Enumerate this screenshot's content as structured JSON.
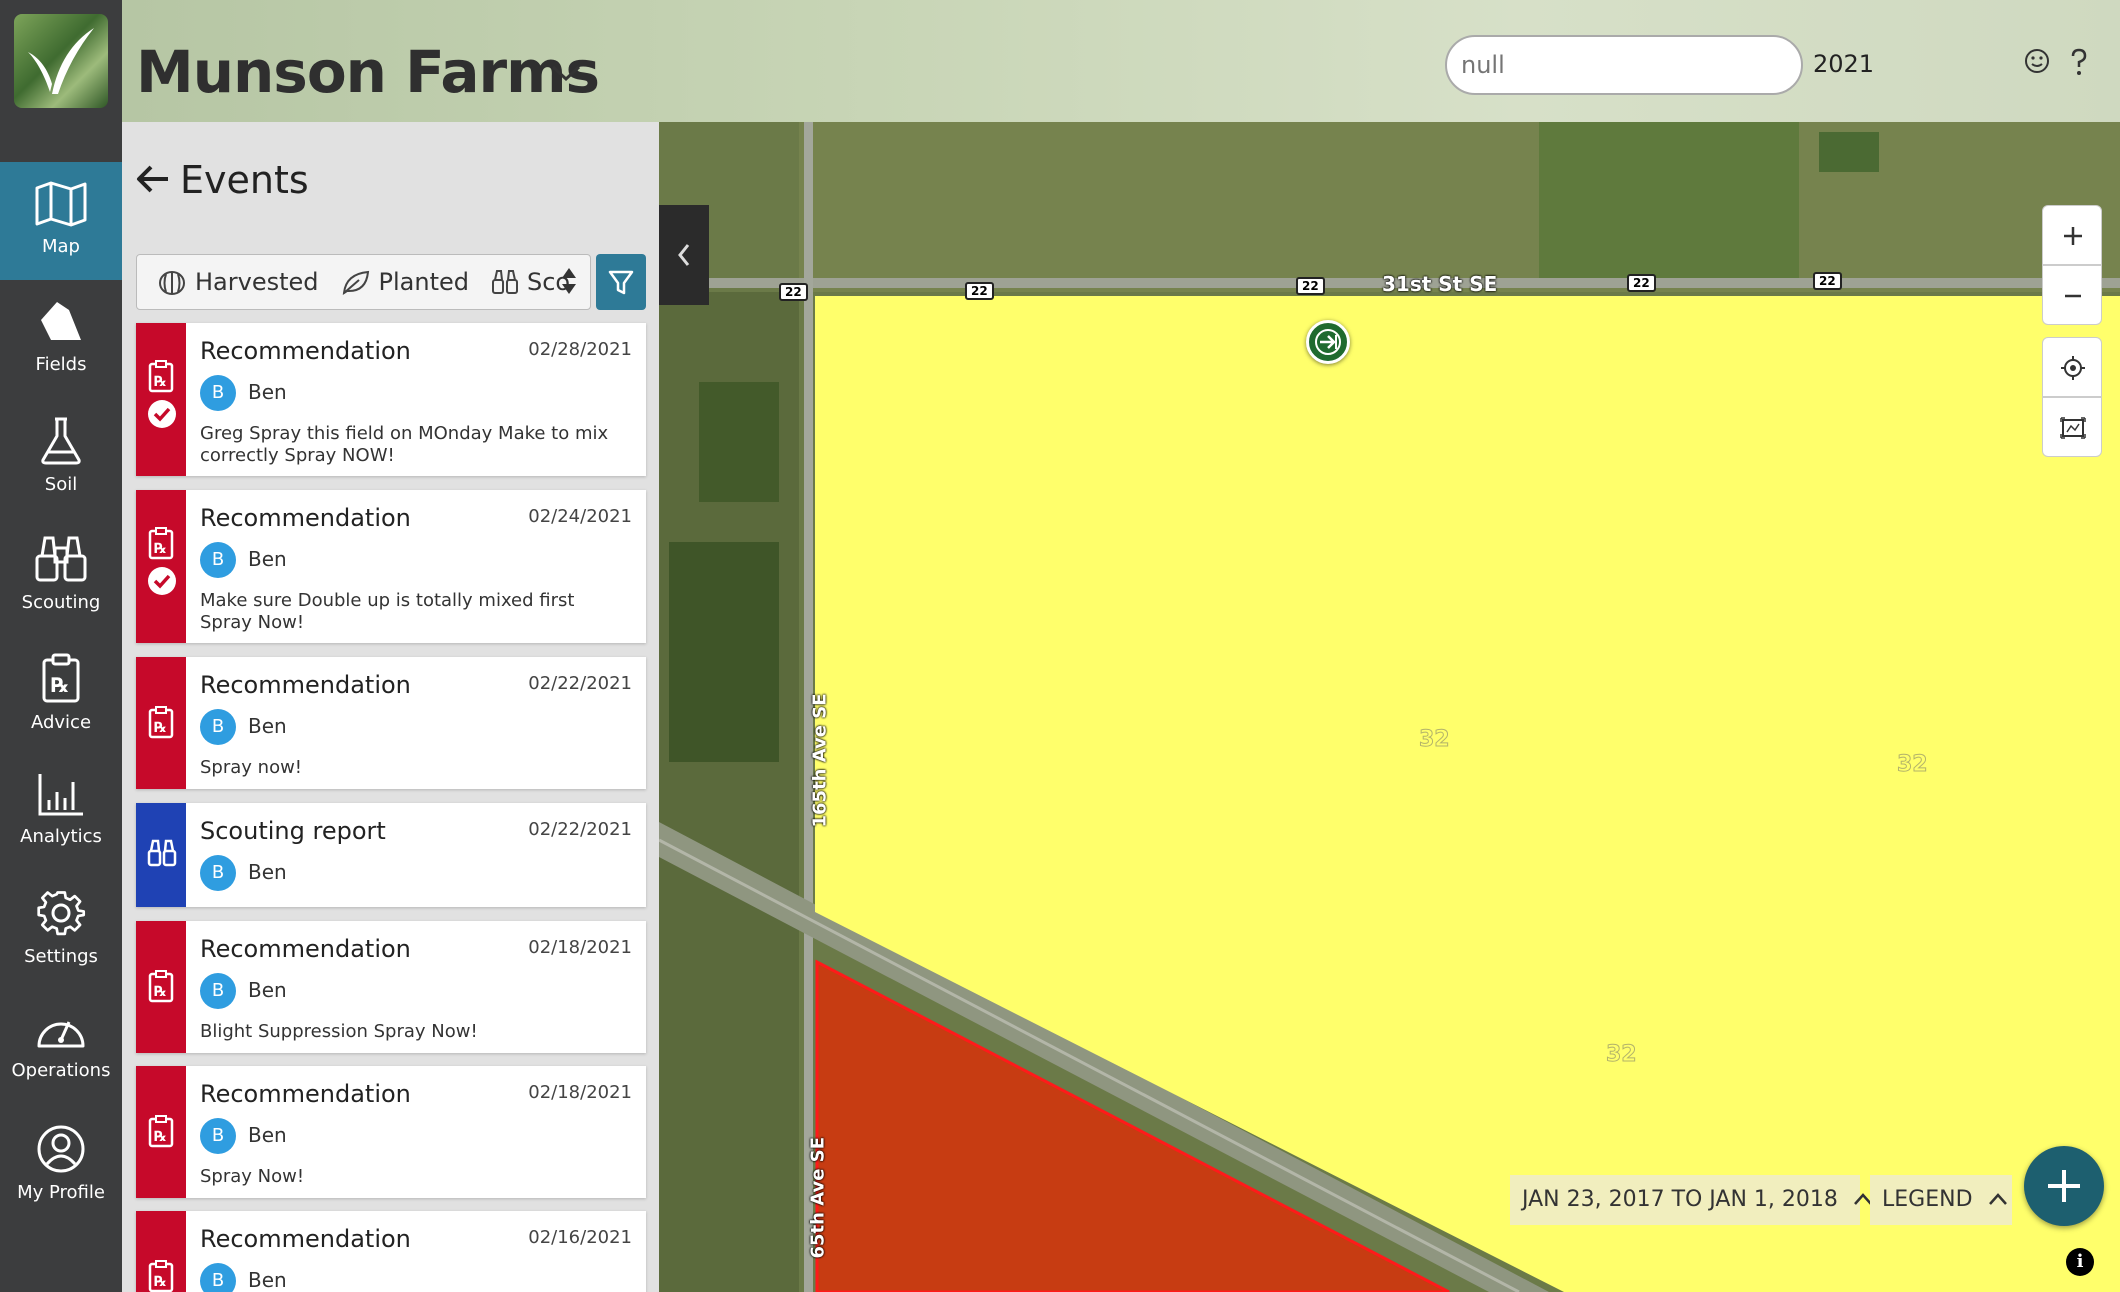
{
  "header": {
    "farm_name": "Munson Farms",
    "search_placeholder": "null",
    "year": "2021"
  },
  "nav": {
    "items": [
      {
        "label": "Map",
        "icon": "map-icon",
        "active": true
      },
      {
        "label": "Fields",
        "icon": "fields-icon"
      },
      {
        "label": "Soil",
        "icon": "flask-icon"
      },
      {
        "label": "Scouting",
        "icon": "binoculars-icon"
      },
      {
        "label": "Advice",
        "icon": "prescription-clipboard-icon"
      },
      {
        "label": "Analytics",
        "icon": "bar-chart-icon"
      },
      {
        "label": "Settings",
        "icon": "gear-icon"
      },
      {
        "label": "Operations",
        "icon": "gauge-icon"
      },
      {
        "label": "My Profile",
        "icon": "user-circle-icon"
      }
    ]
  },
  "panel": {
    "title": "Events",
    "filters": [
      {
        "label": "Harvested",
        "icon": "harvest-icon"
      },
      {
        "label": "Planted",
        "icon": "leaf-icon"
      },
      {
        "label": "Sco",
        "icon": "binoculars-icon"
      }
    ],
    "events": [
      {
        "type": "Recommendation",
        "date": "02/28/2021",
        "initial": "B",
        "user": "Ben",
        "note": "Greg Spray this field on MOnday Make to mix correctly Spray NOW!",
        "kind": "rx",
        "completed": true
      },
      {
        "type": "Recommendation",
        "date": "02/24/2021",
        "initial": "B",
        "user": "Ben",
        "note": "Make sure Double up is totally mixed first Spray Now!",
        "kind": "rx",
        "completed": true
      },
      {
        "type": "Recommendation",
        "date": "02/22/2021",
        "initial": "B",
        "user": "Ben",
        "note": "Spray now!",
        "kind": "rx",
        "completed": false
      },
      {
        "type": "Scouting report",
        "date": "02/22/2021",
        "initial": "B",
        "user": "Ben",
        "note": "",
        "kind": "scout",
        "completed": false
      },
      {
        "type": "Recommendation",
        "date": "02/18/2021",
        "initial": "B",
        "user": "Ben",
        "note": "Blight Suppression Spray Now!",
        "kind": "rx",
        "completed": false
      },
      {
        "type": "Recommendation",
        "date": "02/18/2021",
        "initial": "B",
        "user": "Ben",
        "note": "Spray Now!",
        "kind": "rx",
        "completed": false
      },
      {
        "type": "Recommendation",
        "date": "02/16/2021",
        "initial": "B",
        "user": "Ben",
        "note": "",
        "kind": "rx",
        "completed": false
      }
    ]
  },
  "map": {
    "road_labels": {
      "top_road": "31st St SE",
      "side_road": "165th Ave SE",
      "side_road_lower": "65th Ave SE"
    },
    "highway_shields": [
      "22",
      "22",
      "22",
      "22",
      "22"
    ],
    "section_numbers": [
      "32",
      "32",
      "32"
    ],
    "date_range": "JAN 23, 2017 TO JAN 1, 2018",
    "legend_label": "LEGEND",
    "info_label": "i",
    "colors": {
      "field_yellow": "#ffff6b",
      "field_red": "#c73c12",
      "accent": "#2e7a97"
    }
  }
}
